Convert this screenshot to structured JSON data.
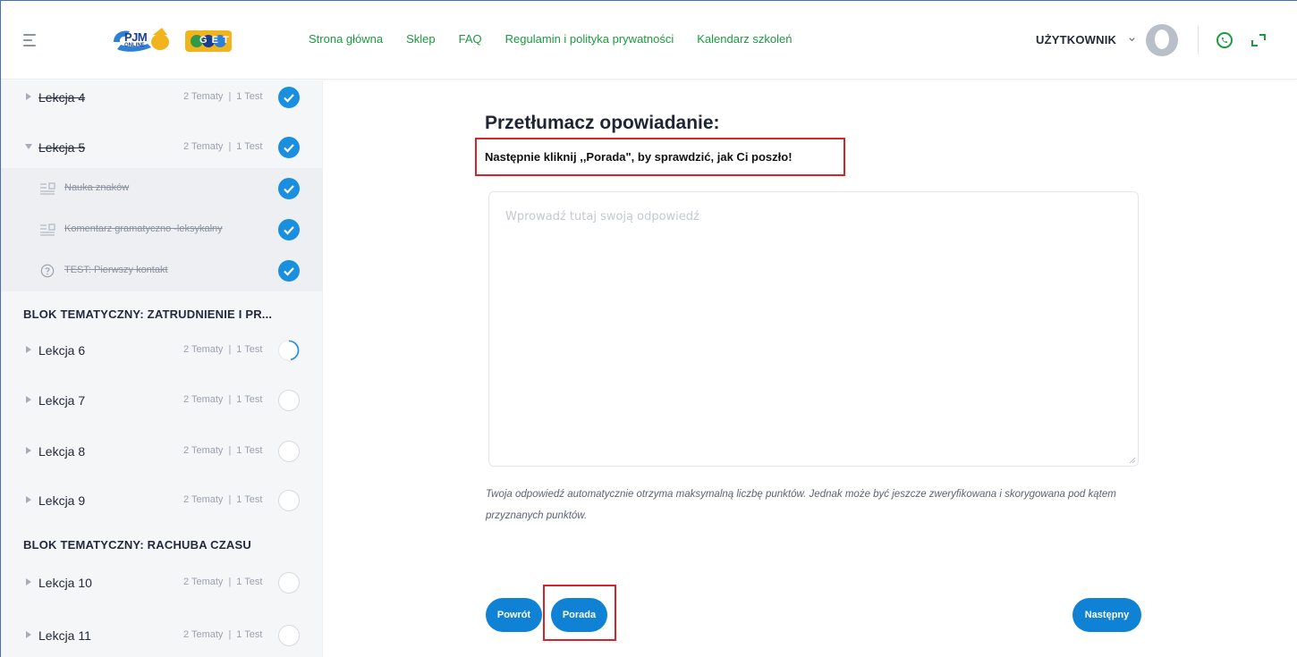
{
  "header": {
    "logo": {
      "text": "PJM",
      "sub": "ONLINE",
      "badge": "G E T"
    },
    "nav": [
      "Strona główna",
      "Sklep",
      "FAQ",
      "Regulamin i polityka prywatności",
      "Kalendarz szkoleń"
    ],
    "user_label": "UŻYTKOWNIK",
    "icons": [
      "hamburger-icon",
      "chevron-down-icon",
      "avatar",
      "whatsapp-icon",
      "expand-icon"
    ],
    "colors": {
      "nav": "#1c9a3f",
      "accent": "#0f82d6",
      "highlight": "#d8232a"
    }
  },
  "sidebar": {
    "lessons_top": [
      {
        "label": "Lekcja 4",
        "topics": "2 Tematy",
        "tests": "1 Test",
        "status": "done",
        "expanded": false
      },
      {
        "label": "Lekcja 5",
        "topics": "2 Tematy",
        "tests": "1 Test",
        "status": "done",
        "expanded": true
      }
    ],
    "subitems": [
      {
        "label": "Nauka znaków",
        "icon": "topic-icon",
        "status": "done"
      },
      {
        "label": "Komentarz gramatyczno -leksykalny",
        "icon": "topic-icon",
        "status": "done"
      },
      {
        "label": "TEST: Pierwszy kontakt",
        "icon": "question-icon",
        "status": "done"
      }
    ],
    "block1": "BLOK TEMATYCZNY: ZATRUDNIENIE I PR...",
    "lessons_mid": [
      {
        "label": "Lekcja 6",
        "topics": "2 Tematy",
        "tests": "1 Test",
        "status": "partial"
      },
      {
        "label": "Lekcja 7",
        "topics": "2 Tematy",
        "tests": "1 Test",
        "status": "empty"
      },
      {
        "label": "Lekcja 8",
        "topics": "2 Tematy",
        "tests": "1 Test",
        "status": "empty"
      },
      {
        "label": "Lekcja 9",
        "topics": "2 Tematy",
        "tests": "1 Test",
        "status": "empty"
      }
    ],
    "block2": "BLOK TEMATYCZNY: RACHUBA CZASU",
    "lessons_bottom": [
      {
        "label": "Lekcja 10",
        "topics": "2 Tematy",
        "tests": "1 Test",
        "status": "empty"
      },
      {
        "label": "Lekcja 11",
        "topics": "2 Tematy",
        "tests": "1 Test",
        "status": "empty"
      }
    ]
  },
  "main": {
    "title": "Przetłumacz opowiadanie:",
    "instruction": "Następnie kliknij ,,Porada\", by sprawdzić, jak Ci poszło!",
    "answer_placeholder": "Wprowadź tutaj swoją odpowiedź",
    "answer_value": "",
    "note": "Twoja odpowiedź automatycznie otrzyma maksymalną liczbę punktów. Jednak może być jeszcze zweryfikowana i skorygowana pod kątem przyznanych punktów.",
    "buttons": {
      "back": "Powrót",
      "tip": "Porada",
      "next": "Następny"
    }
  }
}
